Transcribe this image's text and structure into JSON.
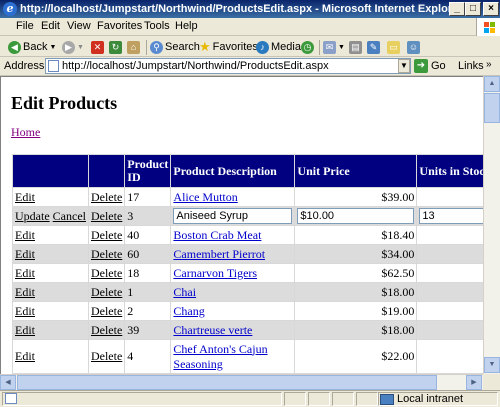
{
  "window": {
    "title": "http://localhost/Jumpstart/Northwind/ProductsEdit.aspx - Microsoft Internet Explorer",
    "buttons": [
      "_",
      "□",
      "×"
    ]
  },
  "menu": [
    "File",
    "Edit",
    "View",
    "Favorites",
    "Tools",
    "Help"
  ],
  "toolbar": {
    "back": "Back",
    "search": "Search",
    "favorites": "Favorites",
    "media": "Media"
  },
  "address": {
    "label": "Address",
    "url": "http://localhost/Jumpstart/Northwind/ProductsEdit.aspx",
    "go": "Go",
    "links": "Links"
  },
  "page": {
    "title": "Edit Products",
    "home_link": "Home"
  },
  "grid": {
    "headers": [
      "",
      "",
      "Product ID",
      "Product Description",
      "Unit Price",
      "Units in Stoc"
    ],
    "edit_label": "Edit",
    "update_label": "Update",
    "cancel_label": "Cancel",
    "delete_label": "Delete",
    "edit_row": {
      "id": "3",
      "name": "Aniseed Syrup",
      "price": "$10.00",
      "units": "13"
    },
    "rows": [
      {
        "id": "17",
        "name": "Alice Mutton",
        "price": "$39.00"
      },
      {
        "id": "40",
        "name": "Boston Crab Meat",
        "price": "$18.40"
      },
      {
        "id": "60",
        "name": "Camembert Pierrot",
        "price": "$34.00"
      },
      {
        "id": "18",
        "name": "Carnarvon Tigers",
        "price": "$62.50"
      },
      {
        "id": "1",
        "name": "Chai",
        "price": "$18.00"
      },
      {
        "id": "2",
        "name": "Chang",
        "price": "$19.00"
      },
      {
        "id": "39",
        "name": "Chartreuse verte",
        "price": "$18.00"
      },
      {
        "id": "4",
        "name": "Chef Anton's Cajun Seasoning",
        "name_line1": "Chef Anton's Cajun",
        "name_line2": "Seasoning",
        "price": "$22.00"
      }
    ]
  },
  "status": {
    "zone": "Local intranet"
  },
  "colors": {
    "header_bg": "#000080",
    "alt_row_bg": "#dcdcdc",
    "link": "#0000cc",
    "visited_link": "#800080"
  }
}
